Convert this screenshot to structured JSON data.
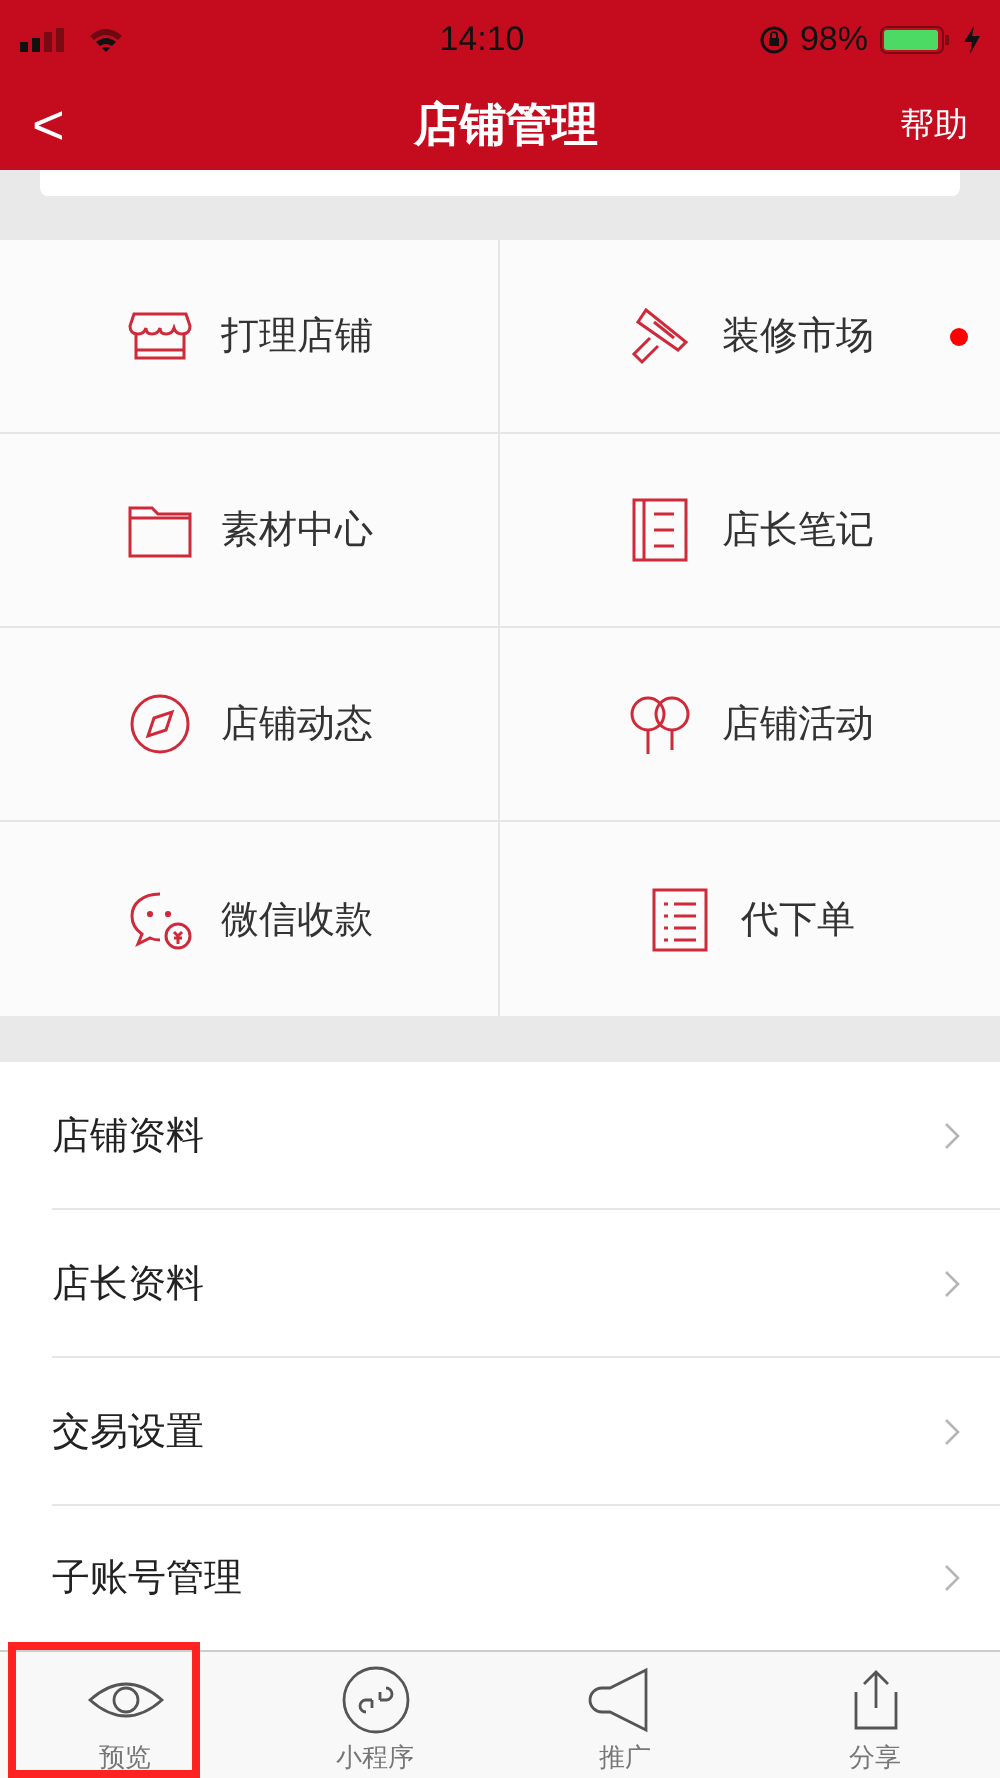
{
  "status_bar": {
    "time": "14:10",
    "battery": "98%"
  },
  "nav": {
    "back": "<",
    "title": "店铺管理",
    "action": "帮助"
  },
  "grid": [
    {
      "kind": "store",
      "label": "打理店铺",
      "badge": false
    },
    {
      "kind": "brush",
      "label": "装修市场",
      "badge": true
    },
    {
      "kind": "folder",
      "label": "素材中心",
      "badge": false
    },
    {
      "kind": "notebook",
      "label": "店长笔记",
      "badge": false
    },
    {
      "kind": "compass",
      "label": "店铺动态",
      "badge": false
    },
    {
      "kind": "balloons",
      "label": "店铺活动",
      "badge": false
    },
    {
      "kind": "chat",
      "label": "微信收款",
      "badge": false
    },
    {
      "kind": "list",
      "label": "代下单",
      "badge": false
    }
  ],
  "list": [
    "店铺资料",
    "店长资料",
    "交易设置",
    "子账号管理"
  ],
  "tab_bar": [
    {
      "kind": "eye",
      "label": "预览"
    },
    {
      "kind": "link",
      "label": "小程序"
    },
    {
      "kind": "megaphone",
      "label": "推广"
    },
    {
      "kind": "share",
      "label": "分享"
    }
  ]
}
